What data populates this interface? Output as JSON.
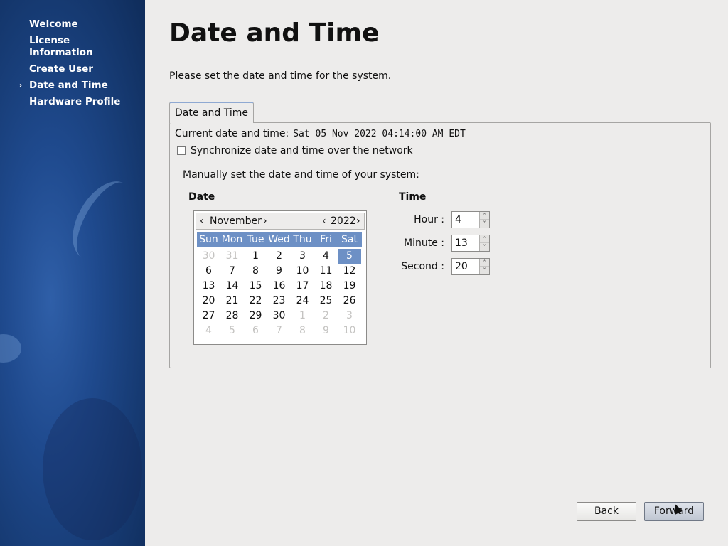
{
  "sidebar": {
    "items": [
      {
        "label": "Welcome"
      },
      {
        "label": "License Information"
      },
      {
        "label": "Create User"
      },
      {
        "label": "Date and Time",
        "current_marker": "›"
      },
      {
        "label": "Hardware Profile"
      }
    ]
  },
  "page": {
    "title": "Date and Time",
    "subtitle": "Please set the date and time for the system."
  },
  "tab": {
    "label": "Date and Time"
  },
  "current": {
    "label": "Current date and time:",
    "value": "Sat 05 Nov 2022 04:14:00 AM EDT"
  },
  "sync": {
    "label": "Synchronize date and time over the network",
    "checked": false
  },
  "manual_label": "Manually set the date and time of your system:",
  "date_section": {
    "label": "Date"
  },
  "time_section": {
    "label": "Time"
  },
  "calendar": {
    "prev_month": "‹",
    "month": "November",
    "next_month": "›",
    "prev_year": "‹",
    "year": "2022",
    "next_year": "›",
    "weekdays": [
      "Sun",
      "Mon",
      "Tue",
      "Wed",
      "Thu",
      "Fri",
      "Sat"
    ],
    "days": [
      {
        "d": "30",
        "other": true
      },
      {
        "d": "31",
        "other": true
      },
      {
        "d": "1"
      },
      {
        "d": "2"
      },
      {
        "d": "3"
      },
      {
        "d": "4"
      },
      {
        "d": "5",
        "selected": true
      },
      {
        "d": "6"
      },
      {
        "d": "7"
      },
      {
        "d": "8"
      },
      {
        "d": "9"
      },
      {
        "d": "10"
      },
      {
        "d": "11"
      },
      {
        "d": "12"
      },
      {
        "d": "13"
      },
      {
        "d": "14"
      },
      {
        "d": "15"
      },
      {
        "d": "16"
      },
      {
        "d": "17"
      },
      {
        "d": "18"
      },
      {
        "d": "19"
      },
      {
        "d": "20"
      },
      {
        "d": "21"
      },
      {
        "d": "22"
      },
      {
        "d": "23"
      },
      {
        "d": "24"
      },
      {
        "d": "25"
      },
      {
        "d": "26"
      },
      {
        "d": "27"
      },
      {
        "d": "28"
      },
      {
        "d": "29"
      },
      {
        "d": "30"
      },
      {
        "d": "1",
        "other": true
      },
      {
        "d": "2",
        "other": true
      },
      {
        "d": "3",
        "other": true
      },
      {
        "d": "4",
        "other": true
      },
      {
        "d": "5",
        "other": true
      },
      {
        "d": "6",
        "other": true
      },
      {
        "d": "7",
        "other": true
      },
      {
        "d": "8",
        "other": true
      },
      {
        "d": "9",
        "other": true
      },
      {
        "d": "10",
        "other": true
      }
    ]
  },
  "time": {
    "hour": {
      "label": "Hour :",
      "value": "4"
    },
    "minute": {
      "label": "Minute :",
      "value": "13"
    },
    "second": {
      "label": "Second :",
      "value": "20"
    },
    "spin_up": "˄",
    "spin_down": "˅"
  },
  "buttons": {
    "back": "Back",
    "forward": "Forward"
  },
  "colors": {
    "sidebar": "#1f4a8e",
    "selection": "#6d90c5"
  }
}
